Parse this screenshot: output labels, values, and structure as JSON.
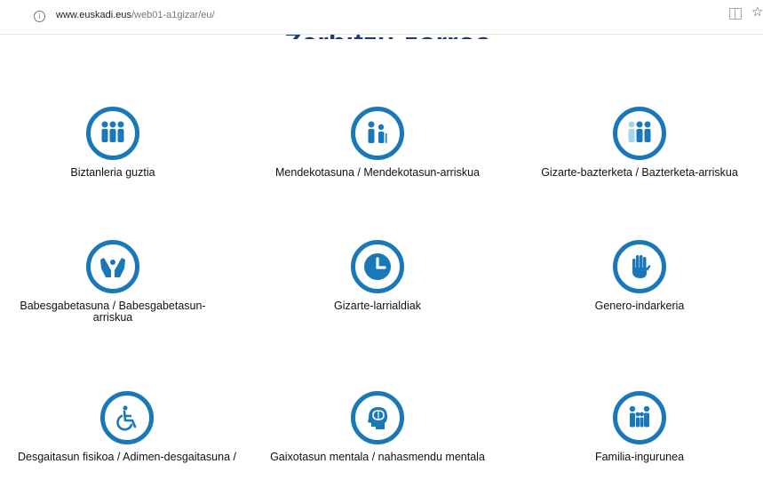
{
  "browser": {
    "url_domain": "www.euskadi.eus",
    "url_path": "/web01-a1gizar/eu/"
  },
  "page": {
    "title": "Zerbitzu-zorroa"
  },
  "services": [
    {
      "label": "Biztanleria guztia",
      "icon": "people-group-icon"
    },
    {
      "label": "Mendekotasuna / Mendekotasun-arriskua",
      "icon": "elderly-care-icon"
    },
    {
      "label": "Gizarte-bazterketa / Bazterketa-arriskua",
      "icon": "excluded-person-icon"
    },
    {
      "label": "Babesgabetasuna / Babesgabetasun-arriskua",
      "icon": "protecting-hands-icon"
    },
    {
      "label": "Gizarte-larrialdiak",
      "icon": "clock-icon"
    },
    {
      "label": "Genero-indarkeria",
      "icon": "stop-hand-icon"
    },
    {
      "label": "Desgaitasun fisikoa / Adimen-desgaitasuna /",
      "icon": "wheelchair-icon"
    },
    {
      "label": "Gaixotasun mentala / nahasmendu mentala",
      "icon": "head-brain-icon"
    },
    {
      "label": "Familia-ingurunea",
      "icon": "family-icon"
    }
  ],
  "colors": {
    "accent": "#1978b8",
    "light_accent": "#a8d3ee",
    "title": "#1f3b73"
  }
}
